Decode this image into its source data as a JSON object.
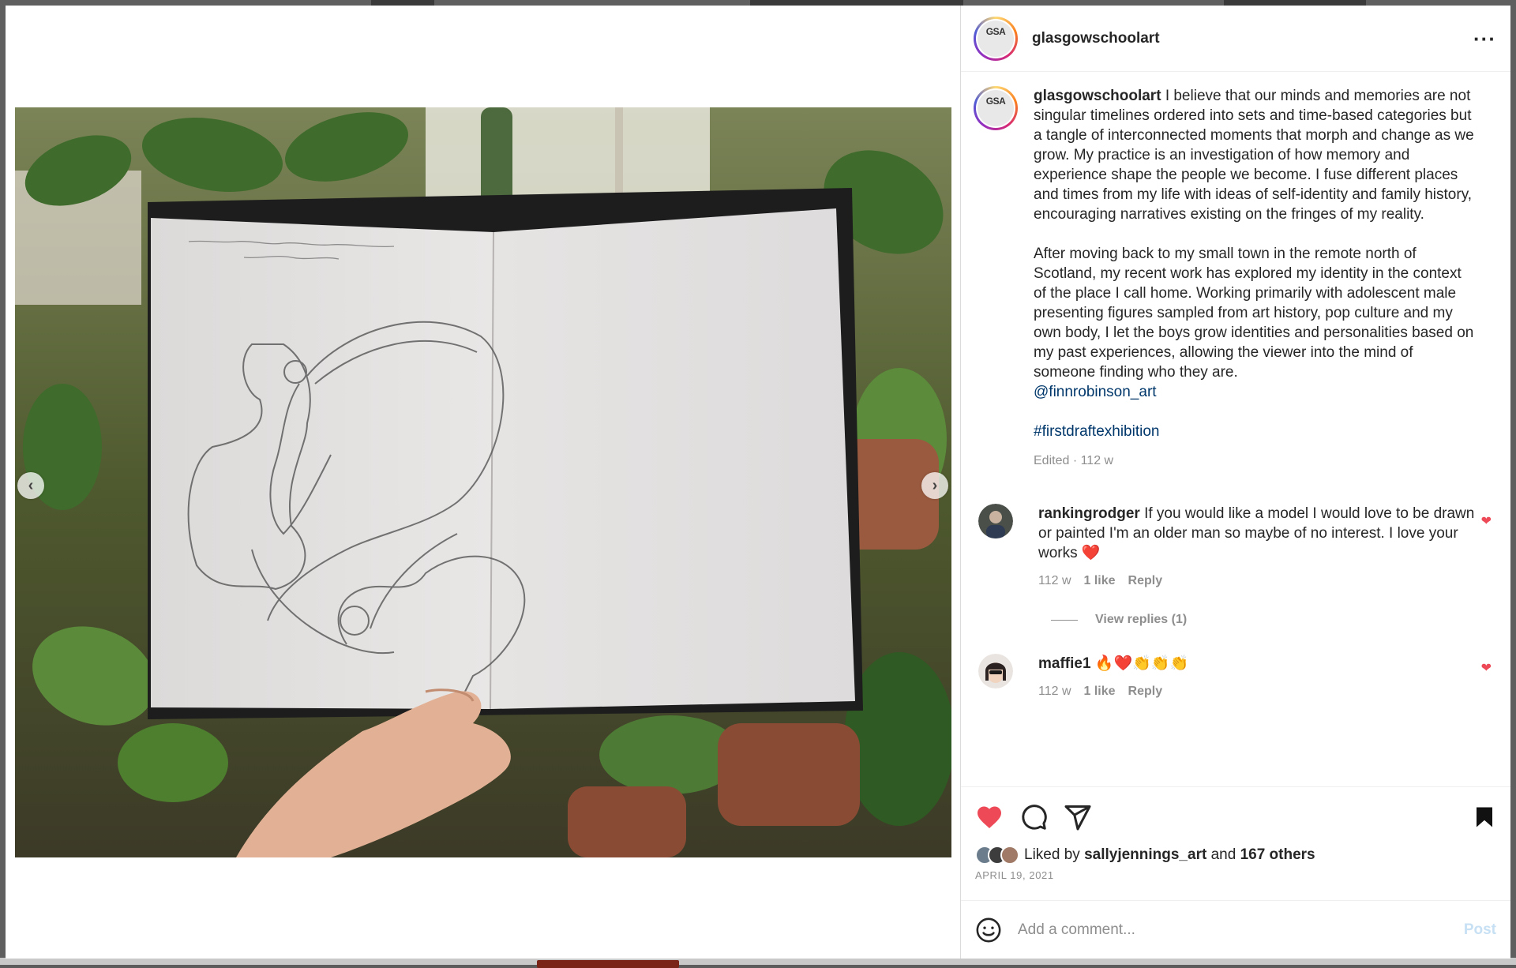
{
  "post": {
    "username": "glasgowschoolart",
    "avatar_logo_text": "GSA",
    "caption_para1": "I believe that our minds and memories are not singular timelines ordered into sets and time-based categories but a tangle of interconnected moments that morph and change as we grow. My practice is an investigation of how memory and experience shape the people we become. I fuse different places and times from my life with ideas of self-identity and family history, encouraging narratives existing on the fringes of my reality.",
    "caption_para2": "After moving back to my small town in the remote north of Scotland, my recent work has explored my identity in the context of the place I call home. Working primarily with adolescent male presenting figures sampled from art history, pop culture and my own body, I let the boys grow identities and personalities based on my past experiences, allowing the viewer into the mind of someone finding who they are.",
    "mention": "@finnrobinson_art",
    "hashtag": "#firstdraftexhibition",
    "edited_meta": "Edited · 112 w",
    "sketch_note_line1": "As the last light of the day streamed in",
    "sketch_note_line2": "onto me, I cried."
  },
  "comments": [
    {
      "username": "rankingrodger",
      "text": "If you would like a model I would love to be drawn or painted I'm an older man so maybe of no interest. I love your works ❤️",
      "age": "112 w",
      "likes": "1 like",
      "reply_label": "Reply",
      "view_replies": "View replies (1)"
    },
    {
      "username": "maffie1",
      "text": "🔥❤️👏👏👏",
      "age": "112 w",
      "likes": "1 like",
      "reply_label": "Reply"
    }
  ],
  "footer": {
    "liked_prefix": "Liked by",
    "liked_user": "sallyjennings_art",
    "liked_and": "and",
    "liked_others": "167 others",
    "date": "APRIL 19, 2021",
    "comment_placeholder": "Add a comment...",
    "post_label": "Post"
  },
  "icons": {
    "heart_active_color": "#ed4956",
    "link_color": "#00376b",
    "post_button_color": "#c7e0f4"
  }
}
